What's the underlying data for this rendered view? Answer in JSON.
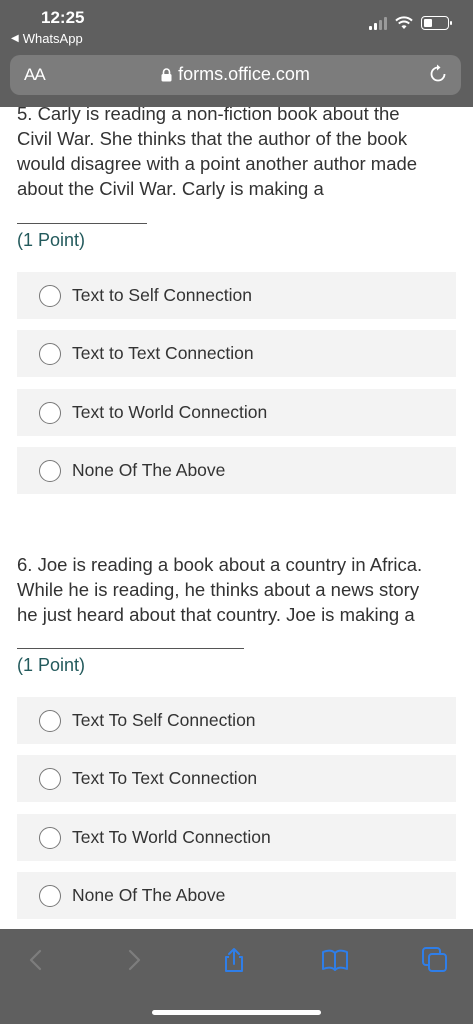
{
  "status_bar": {
    "time": "12:25",
    "back_app": "WhatsApp"
  },
  "browser": {
    "text_size_label": "AA",
    "url": "forms.office.com"
  },
  "questions": [
    {
      "text_lines": [
        "5. Carly is reading a non-fiction book about the",
        "Civil War. She thinks that the author of the book",
        "would disagree with a point another author made",
        "about the Civil War. Carly is making a"
      ],
      "points": "(1 Point)",
      "options": [
        "Text to Self Connection",
        "Text to Text Connection",
        "Text to World Connection",
        "None Of The Above"
      ]
    },
    {
      "text_lines": [
        "6. Joe is reading a book about a country in Africa.",
        "While he is reading, he thinks about a news story",
        "he just heard about that country. Joe is making a"
      ],
      "points": "(1 Point)",
      "options": [
        "Text To Self Connection",
        "Text To Text Connection",
        "Text To World Connection",
        "None Of The Above"
      ]
    }
  ],
  "toolbar": {
    "icons": [
      "back-icon",
      "forward-icon",
      "share-icon",
      "bookmarks-icon",
      "tabs-icon"
    ],
    "accent_color": "#2f7ee8"
  }
}
